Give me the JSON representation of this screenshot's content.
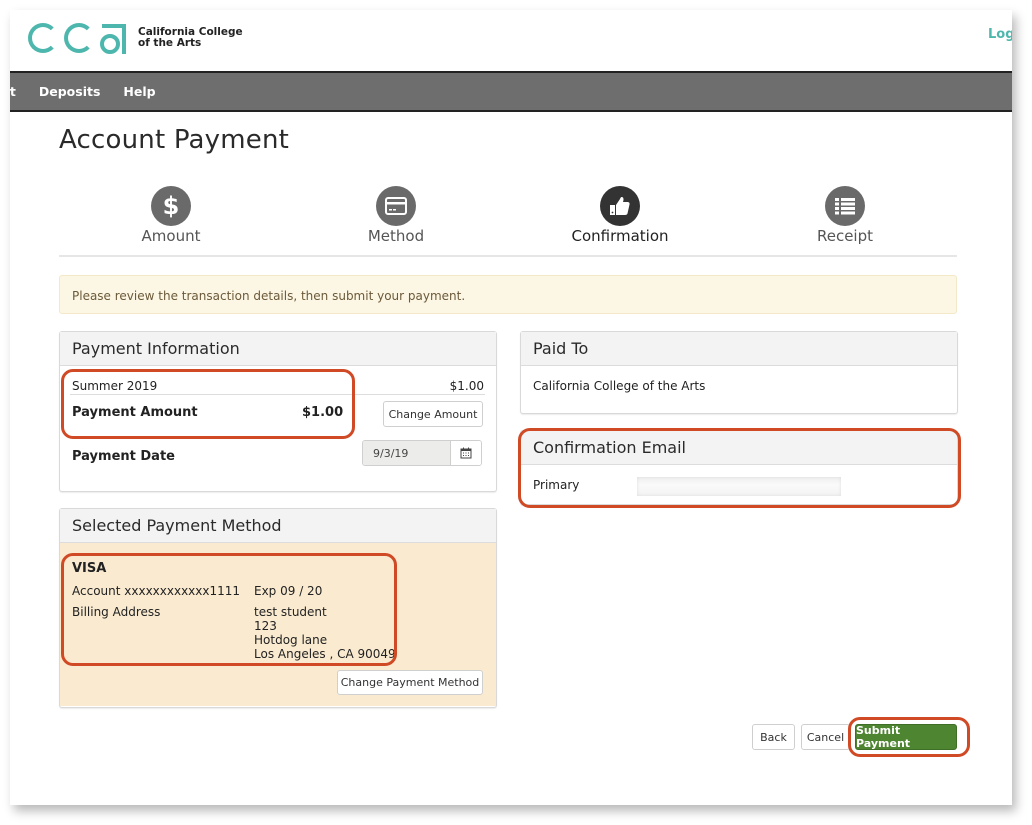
{
  "header": {
    "logo_text_line1": "California College",
    "logo_text_line2": "of the Arts",
    "login_link": "Logout"
  },
  "nav": {
    "items": [
      {
        "label": "nt"
      },
      {
        "label": "Deposits"
      },
      {
        "label": "Help"
      }
    ]
  },
  "page": {
    "title": "Account Payment"
  },
  "steps": [
    {
      "label": "Amount",
      "icon": "dollar-icon",
      "active": false
    },
    {
      "label": "Method",
      "icon": "credit-card-icon",
      "active": false
    },
    {
      "label": "Confirmation",
      "icon": "thumbs-up-icon",
      "active": true
    },
    {
      "label": "Receipt",
      "icon": "list-icon",
      "active": false
    }
  ],
  "alert": {
    "message": "Please review the transaction details, then submit your payment."
  },
  "payment_information": {
    "heading": "Payment Information",
    "term_label": "Summer 2019",
    "term_amount": "$1.00",
    "amount_label": "Payment Amount",
    "amount_value": "$1.00",
    "change_amount_button": "Change Amount",
    "date_label": "Payment Date",
    "date_value": "9/3/19"
  },
  "paid_to": {
    "heading": "Paid To",
    "value": "California College of the Arts"
  },
  "confirmation_email": {
    "heading": "Confirmation Email",
    "primary_label": "Primary"
  },
  "selected_payment_method": {
    "heading": "Selected Payment Method",
    "card_type": "VISA",
    "account": "Account xxxxxxxxxxxx1111",
    "expiry": "Exp 09 / 20",
    "billing_label": "Billing Address",
    "billing_lines": [
      "test student",
      "123",
      "Hotdog lane",
      "Los Angeles , CA 90049"
    ],
    "change_method_button": "Change Payment Method"
  },
  "actions": {
    "back": "Back",
    "cancel": "Cancel",
    "submit": "Submit Payment"
  },
  "colors": {
    "brand_teal": "#4db7ad",
    "highlight": "#d04a26",
    "submit_green": "#4e8531",
    "nav_gray": "#6e6e6e"
  }
}
